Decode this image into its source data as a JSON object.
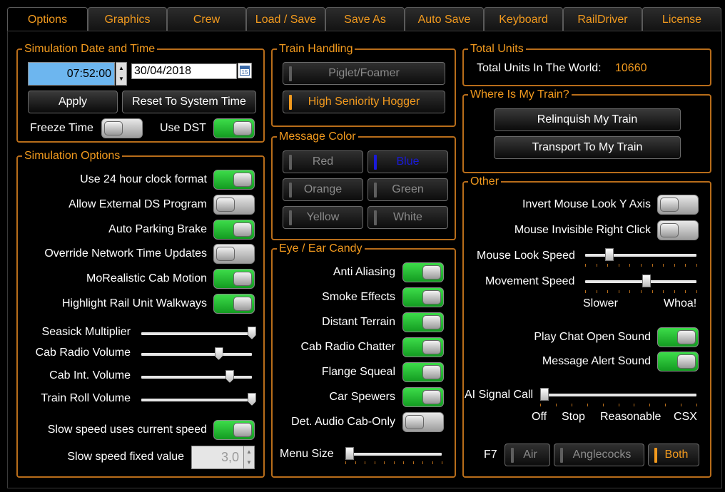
{
  "tabs": [
    "Options",
    "Graphics",
    "Crew",
    "Load / Save",
    "Save As",
    "Auto Save",
    "Keyboard",
    "RailDriver",
    "License"
  ],
  "date_time": {
    "title": "Simulation Date and Time",
    "time_value": "07:52:00",
    "date_value": "30/04/2018",
    "calendar_label": "15",
    "apply_label": "Apply",
    "reset_label": "Reset To System Time",
    "freeze_label": "Freeze Time",
    "dst_label": "Use DST"
  },
  "sim_options": {
    "title": "Simulation Options",
    "toggles": [
      {
        "label": "Use 24 hour clock format",
        "on": true
      },
      {
        "label": "Allow External DS Program",
        "on": false
      },
      {
        "label": "Auto Parking Brake",
        "on": true
      },
      {
        "label": "Override Network Time Updates",
        "on": false
      },
      {
        "label": "MoRealistic Cab Motion",
        "on": true
      },
      {
        "label": "Highlight Rail Unit Walkways",
        "on": true
      }
    ],
    "sliders": [
      {
        "label": "Seasick Multiplier",
        "value": 1.0
      },
      {
        "label": "Cab Radio Volume",
        "value": 0.7
      },
      {
        "label": "Cab Int. Volume",
        "value": 0.8
      },
      {
        "label": "Train Roll Volume",
        "value": 1.0
      }
    ],
    "slow_speed_label": "Slow speed uses current speed",
    "slow_fixed_label": "Slow speed fixed value",
    "slow_fixed_value": "3,0"
  },
  "train_handling": {
    "title": "Train Handling",
    "options": [
      "Piglet/Foamer",
      "High Seniority Hogger"
    ],
    "selected": 1
  },
  "message_color": {
    "title": "Message Color",
    "options": [
      "Red",
      "Blue",
      "Orange",
      "Green",
      "Yellow",
      "White"
    ],
    "selected": 1,
    "colors": {
      "selected_text": "#1a1ad8",
      "selected_ind": "#1a1ad8"
    }
  },
  "eye_candy": {
    "title": "Eye / Ear Candy",
    "toggles": [
      {
        "label": "Anti Aliasing",
        "on": true
      },
      {
        "label": "Smoke Effects",
        "on": true
      },
      {
        "label": "Distant Terrain",
        "on": true
      },
      {
        "label": "Cab Radio Chatter",
        "on": true
      },
      {
        "label": "Flange Squeal",
        "on": true
      },
      {
        "label": "Car Spewers",
        "on": true
      },
      {
        "label": "Det. Audio Cab-Only",
        "on": false
      }
    ],
    "menu_size_label": "Menu Size",
    "menu_size_value": 0.0
  },
  "total_units": {
    "title": "Total Units",
    "label": "Total Units In The World:",
    "value": "10660"
  },
  "where_train": {
    "title": "Where Is My Train?",
    "relinquish_label": "Relinquish My Train",
    "transport_label": "Transport To My Train"
  },
  "other": {
    "title": "Other",
    "invert_label": "Invert Mouse Look Y Axis",
    "invert_on": false,
    "invisible_label": "Mouse Invisible Right Click",
    "invisible_on": false,
    "look_speed_label": "Mouse Look Speed",
    "look_speed_value": 0.22,
    "move_speed_label": "Movement Speed",
    "move_speed_value": 0.55,
    "slower_label": "Slower",
    "whoa_label": "Whoa!",
    "chat_label": "Play Chat Open Sound",
    "chat_on": true,
    "alert_label": "Message Alert Sound",
    "alert_on": true,
    "ai_label": "AI Signal Call",
    "ai_value": 0.0,
    "ai_scale": [
      "Off",
      "Stop",
      "Reasonable",
      "CSX"
    ],
    "f7_label": "F7",
    "f7_options": [
      "Air",
      "Anglecocks",
      "Both"
    ],
    "f7_selected": 2
  },
  "colors": {
    "accent": "#f29a1e",
    "border": "#b86d1a",
    "toggle_on": "#2dbd3a",
    "time_bg": "#6db6ef"
  }
}
